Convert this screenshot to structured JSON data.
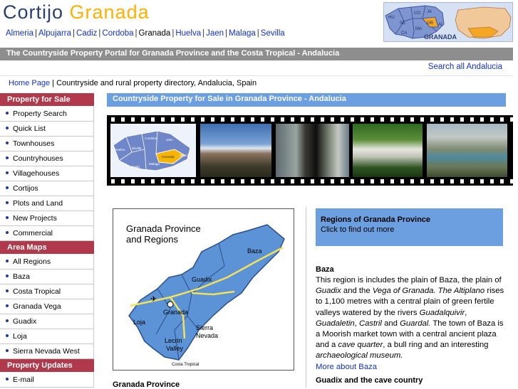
{
  "logo": {
    "word1": "Cortijo",
    "word2": "Granada"
  },
  "citynav": [
    {
      "label": "Almeria",
      "current": false
    },
    {
      "label": "Alpujarra",
      "current": false
    },
    {
      "label": "Cadiz",
      "current": false
    },
    {
      "label": "Cordoba",
      "current": false
    },
    {
      "label": "Granada",
      "current": true
    },
    {
      "label": "Huelva",
      "current": false
    },
    {
      "label": "Jaen",
      "current": false
    },
    {
      "label": "Malaga",
      "current": false
    },
    {
      "label": "Sevilla",
      "current": false
    }
  ],
  "mini_map": {
    "label": "GRANADA",
    "provinces": [
      "HU",
      "SE",
      "CO",
      "JA",
      "MA",
      "GR",
      "AL",
      "CA"
    ]
  },
  "tagline": "The Countryside Property Portal for Granada Province and the Costa Tropical - Andalucia",
  "search_all": "Search all Andalucia",
  "breadcrumb": {
    "home": "Home Page",
    "rest": " | Countryside and rural property directory, Andalucia, Spain"
  },
  "sidebar": {
    "sections": [
      {
        "title": "Property for Sale",
        "items": [
          "Property Search",
          "Quick List",
          "Townhouses",
          "Countryhouses",
          "Villagehouses",
          "Cortijos",
          "Plots and Land",
          "New Projects",
          "Commercial"
        ]
      },
      {
        "title": "Area Maps",
        "items": [
          "All Regions",
          "Baza",
          "Costa Tropical",
          "Granada Vega",
          "Guadix",
          "Loja",
          "Sierra Nevada West"
        ]
      },
      {
        "title": "Property Updates",
        "items": [
          "E-mail"
        ]
      }
    ]
  },
  "section_title": "Countryside Property for Sale in Granada Province - Andalucia",
  "filmstrip_map_labels": [
    "Huelva",
    "Sevilla",
    "Cordoba",
    "Jaen",
    "Granada",
    "Almeria",
    "Malaga",
    "Cadiz"
  ],
  "region_map": {
    "title_line1": "Granada Province",
    "title_line2": "and Regions",
    "labels": {
      "baza": "Baza",
      "guadix": "Guadix",
      "granada": "Granada",
      "loja": "Loja",
      "sierra1": "Sierra",
      "sierra2": "Nevada",
      "lecrin1": "Lecrin",
      "lecrin2": "Valley",
      "costa": "Costa Tropical"
    }
  },
  "regions_box": {
    "title": "Regions of Granada Province",
    "subtitle": "Click to find out more"
  },
  "baza": {
    "heading": "Baza",
    "t1": "This region is includes the plain of Baza, the plain of ",
    "i1": "Guadix",
    "t2": " and the ",
    "i2": "Vega of Granada. The Altiplano",
    "t3": " rises to 1,100 metres with a central plain of green fertile valleys watered by the rivers ",
    "i3": "Guadalquivir",
    "t4": ", ",
    "i4": "Guadaletin",
    "t5": ", ",
    "i5": "Castril",
    "t6": " and ",
    "i6": "Guardal.",
    "t7": " The town of Baza is a Moorish market town with a central ancient plaza and a ",
    "i7": "cave quarter",
    "t8": ", a bull ring and an interesting ",
    "i8": "archaeological museum.",
    "more": "More about Baza"
  },
  "guadix_heading": "Guadix and the cave country",
  "granada_province_heading": "Granada Province"
}
